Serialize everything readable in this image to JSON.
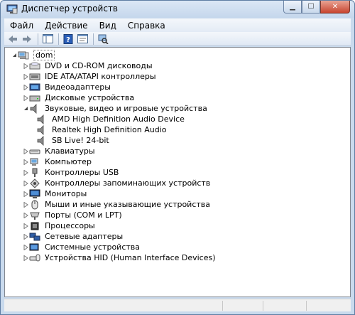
{
  "window": {
    "title": "Диспетчер устройств"
  },
  "menu": [
    "Файл",
    "Действие",
    "Вид",
    "Справка"
  ],
  "tree": {
    "root": "dom",
    "categories": [
      {
        "label": "DVD и CD-ROM дисководы",
        "icon": "dvd-drive-icon",
        "expanded": false
      },
      {
        "label": "IDE ATA/ATAPI контроллеры",
        "icon": "ide-controller-icon",
        "expanded": false
      },
      {
        "label": "Видеоадаптеры",
        "icon": "video-adapter-icon",
        "expanded": false
      },
      {
        "label": "Дисковые устройства",
        "icon": "disk-drive-icon",
        "expanded": false
      },
      {
        "label": "Звуковые, видео и игровые устройства",
        "icon": "speaker-icon",
        "expanded": true,
        "children": [
          "AMD High Definition Audio Device",
          "Realtek High Definition Audio",
          "SB Live! 24-bit"
        ]
      },
      {
        "label": "Клавиатуры",
        "icon": "keyboard-icon",
        "expanded": false
      },
      {
        "label": "Компьютер",
        "icon": "computer-icon",
        "expanded": false
      },
      {
        "label": "Контроллеры USB",
        "icon": "usb-icon",
        "expanded": false
      },
      {
        "label": "Контроллеры запоминающих устройств",
        "icon": "storage-controller-icon",
        "expanded": false
      },
      {
        "label": "Мониторы",
        "icon": "monitor-icon",
        "expanded": false
      },
      {
        "label": "Мыши и иные указывающие устройства",
        "icon": "mouse-icon",
        "expanded": false
      },
      {
        "label": "Порты (COM и LPT)",
        "icon": "port-icon",
        "expanded": false
      },
      {
        "label": "Процессоры",
        "icon": "processor-icon",
        "expanded": false
      },
      {
        "label": "Сетевые адаптеры",
        "icon": "network-adapter-icon",
        "expanded": false
      },
      {
        "label": "Системные устройства",
        "icon": "system-device-icon",
        "expanded": false
      },
      {
        "label": "Устройства HID (Human Interface Devices)",
        "icon": "hid-icon",
        "expanded": false
      }
    ]
  }
}
